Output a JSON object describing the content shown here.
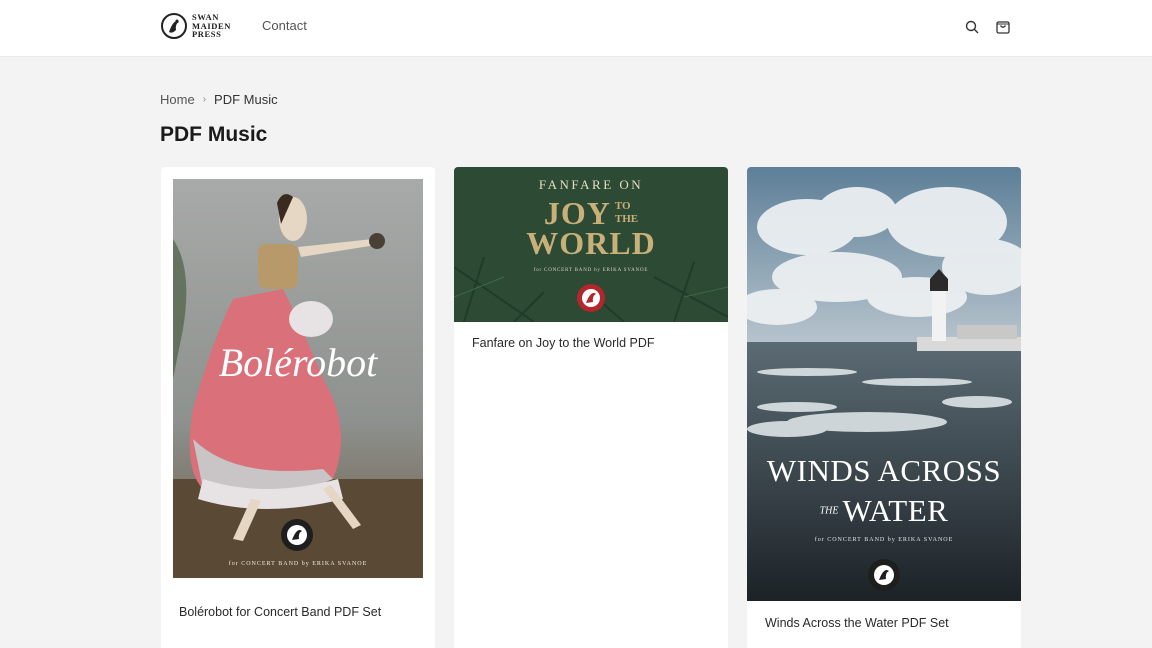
{
  "header": {
    "logo": {
      "line1": "SWAN",
      "line2": "MAIDEN",
      "line3": "PRESS"
    },
    "nav": {
      "contact": "Contact"
    },
    "icons": {
      "search": "search-icon",
      "cart": "cart-icon"
    }
  },
  "breadcrumb": {
    "home": "Home",
    "separator": "›",
    "current": "PDF Music"
  },
  "page": {
    "title": "PDF Music"
  },
  "products": [
    {
      "title": "Bolérobot for Concert Band PDF Set",
      "cover": {
        "title": "Bolérobot",
        "credit": "for CONCERT BAND by ERIKA SVANOE"
      }
    },
    {
      "title": "Fanfare on Joy to the World PDF",
      "cover": {
        "top": "FANFARE ON",
        "joy": "JOY",
        "to": "TO",
        "the": "THE",
        "world": "WORLD",
        "credit": "for CONCERT BAND by ERIKA SVANOE"
      }
    },
    {
      "title": "Winds Across the Water PDF Set",
      "cover": {
        "line1": "WINDS ACROSS",
        "the": "THE",
        "line2": "WATER",
        "credit": "for CONCERT BAND by ERIKA SVANOE"
      }
    }
  ],
  "colors": {
    "pink_dress": "#d9707a",
    "forest_green": "#2c4a34",
    "gold": "#c9b078",
    "sea": "#4a5a63"
  }
}
